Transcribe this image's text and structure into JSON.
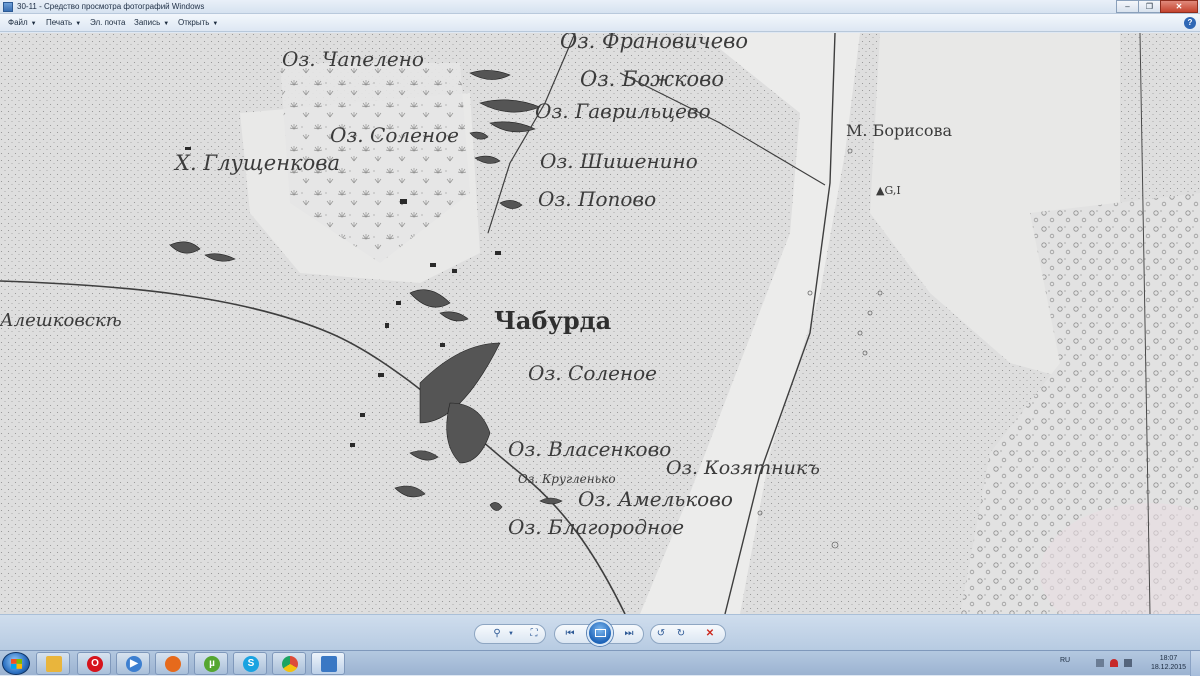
{
  "window": {
    "title": "30-11 - Средство просмотра фотографий Windows",
    "buttons": {
      "minimize": "–",
      "maximize": "❐",
      "close": "✕"
    }
  },
  "menu": {
    "items": [
      {
        "label": "Файл"
      },
      {
        "label": "Печать"
      },
      {
        "label": "Эл. почта"
      },
      {
        "label": "Запись"
      },
      {
        "label": "Открыть"
      }
    ],
    "help": "?"
  },
  "map": {
    "labels": {
      "franovichevo": "Оз. Франовичево",
      "chapeleno": "Оз. Чапелено",
      "bozhkovo": "Оз. Божково",
      "gavriltsevo": "Оз. Гаврильцево",
      "solenoe_top": "Оз. Соленое",
      "glushchenkova": "Х. Глущенкова",
      "shishenino": "Оз. Шишенино",
      "popovo": "Оз. Попово",
      "m_borisova": "М. Борисова",
      "g1": "▲G,I",
      "aleshkovske": "Алешковскѣ",
      "chaburda": "Чабурда",
      "solenoe_mid": "Оз. Соленое",
      "vlasenkovo": "Оз. Власенково",
      "kozyatnik": "Оз. Козятникъ",
      "kruglenko": "Оз. Кругленько",
      "amelkovo": "Оз. Амельково",
      "blagorodnoe": "Оз. Благородное"
    }
  },
  "controls": {
    "zoom_icon": "magnifier-icon",
    "fit_icon": "fit-to-window-icon",
    "prev_icon": "previous-icon",
    "slideshow_icon": "slideshow-icon",
    "next_icon": "next-icon",
    "rotate_ccw_icon": "rotate-counterclockwise-icon",
    "rotate_cw_icon": "rotate-clockwise-icon",
    "delete_icon": "delete-icon"
  },
  "taskbar": {
    "apps": [
      {
        "name": "explorer",
        "color": "#e9b53c"
      },
      {
        "name": "opera",
        "color": "#d6131c"
      },
      {
        "name": "media-player",
        "color": "#3d7fd0"
      },
      {
        "name": "firefox",
        "color": "#e66a1c"
      },
      {
        "name": "utorrent",
        "color": "#55a630"
      },
      {
        "name": "skype",
        "color": "#1aa3e1"
      },
      {
        "name": "chrome",
        "color": "#dd4b39"
      },
      {
        "name": "photo-viewer",
        "color": "#3a78c4"
      }
    ],
    "tray": {
      "language": "RU",
      "time": "18:07",
      "date": "18.12.2015"
    }
  }
}
